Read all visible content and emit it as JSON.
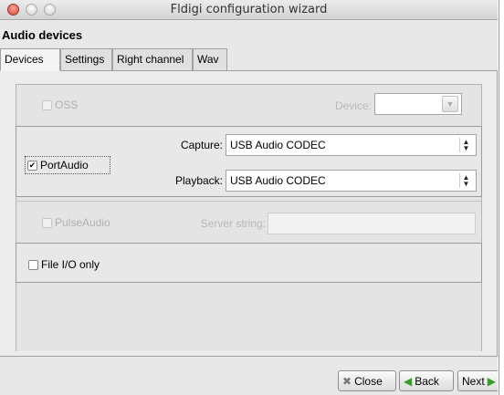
{
  "window": {
    "title": "Fldigi configuration wizard"
  },
  "section": {
    "title": "Audio devices"
  },
  "tabs": [
    {
      "label": "Devices",
      "active": true
    },
    {
      "label": "Settings",
      "active": false
    },
    {
      "label": "Right channel",
      "active": false
    },
    {
      "label": "Wav",
      "active": false
    }
  ],
  "oss": {
    "label": "OSS",
    "checked": false,
    "enabled": false,
    "device_label": "Device:",
    "device_value": ""
  },
  "portaudio": {
    "label": "PortAudio",
    "checked": true,
    "enabled": true,
    "capture_label": "Capture:",
    "capture_value": "USB Audio CODEC",
    "playback_label": "Playback:",
    "playback_value": "USB Audio CODEC"
  },
  "pulseaudio": {
    "label": "PulseAudio",
    "checked": false,
    "enabled": false,
    "server_label": "Server string:",
    "server_value": ""
  },
  "fileio": {
    "label": "File I/O only",
    "checked": false
  },
  "buttons": {
    "close": "Close",
    "back": "Back",
    "next": "Next"
  },
  "icons": {
    "close": "close-x-icon",
    "back": "back-arrow-icon",
    "next": "next-arrow-icon",
    "dropdown": "dropdown-arrow-icon",
    "spinner": "up-down-spinner-icon",
    "check": "checkmark-icon"
  },
  "colors": {
    "accent_green": "#3c9a2e",
    "window_close_red": "#d4483a"
  }
}
